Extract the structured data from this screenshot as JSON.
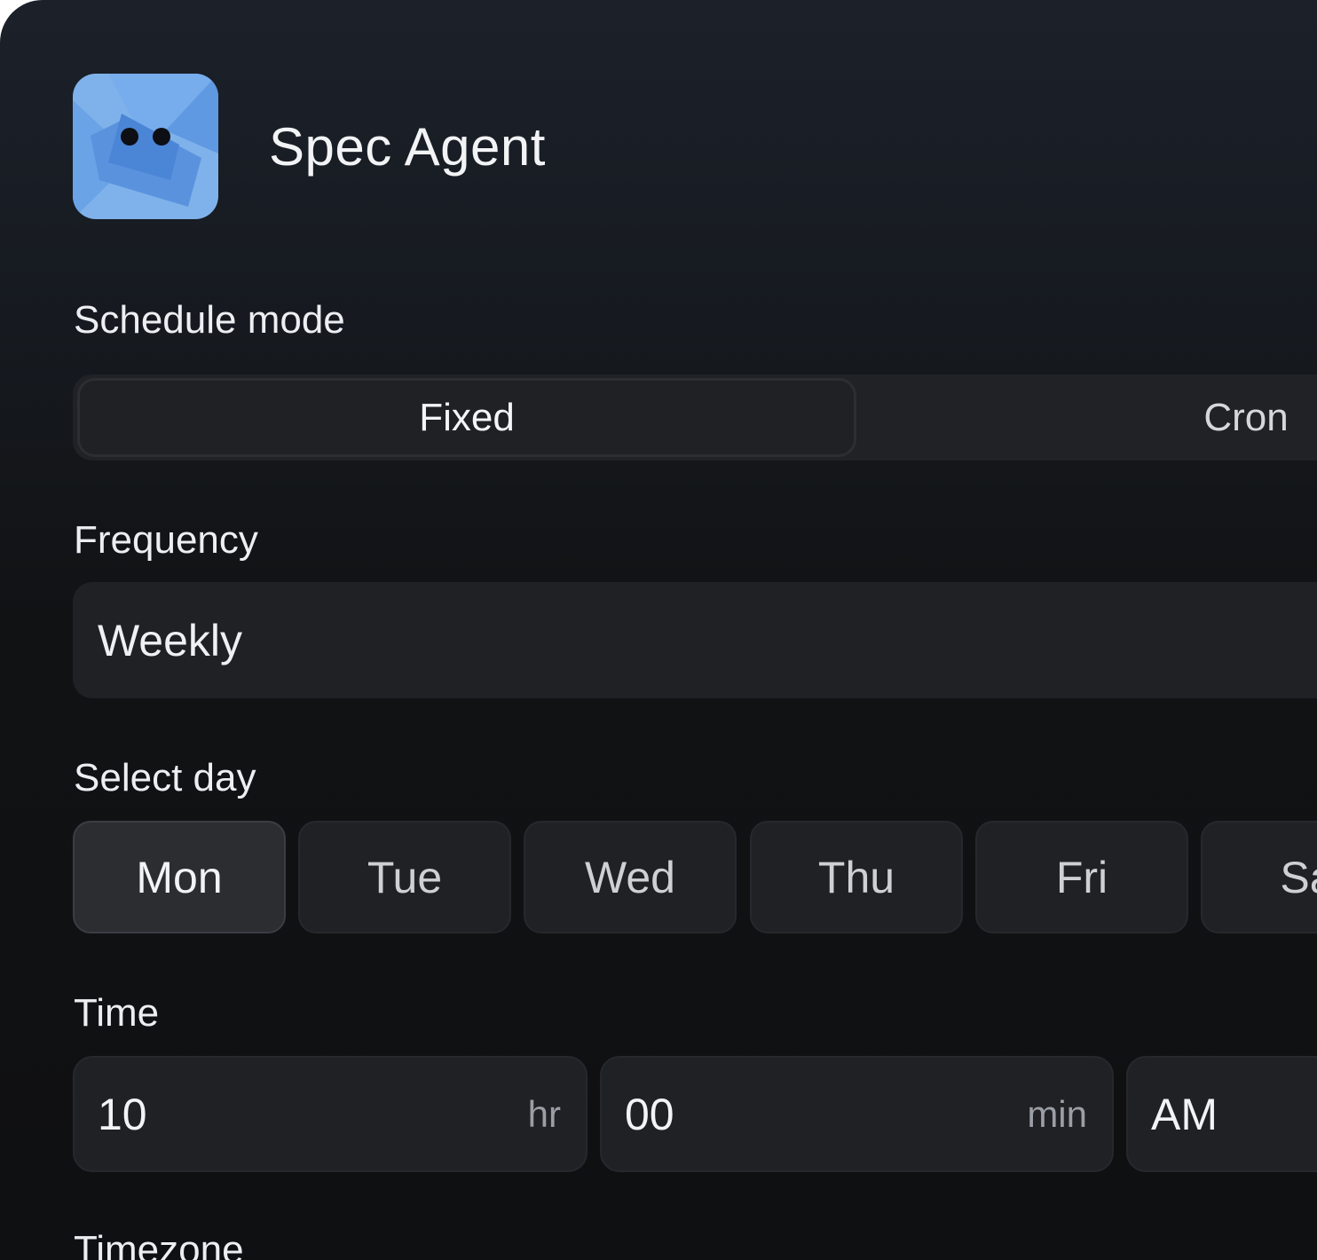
{
  "agent": {
    "name": "Spec Agent",
    "icon": "robot-face-icon"
  },
  "schedule_mode": {
    "label": "Schedule mode",
    "options": [
      "Fixed",
      "Cron"
    ],
    "selected": "Fixed"
  },
  "frequency": {
    "label": "Frequency",
    "value": "Weekly"
  },
  "select_day": {
    "label": "Select day",
    "days": [
      "Mon",
      "Tue",
      "Wed",
      "Thu",
      "Fri",
      "Sa"
    ],
    "selected": "Mon"
  },
  "time": {
    "label": "Time",
    "hour": "10",
    "hour_unit": "hr",
    "minute": "00",
    "minute_unit": "min",
    "period": "AM"
  },
  "timezone": {
    "label": "Timezone"
  },
  "colors": {
    "icon_blue": "#5b95e0",
    "selected_day_bg": "#2b2d31"
  }
}
